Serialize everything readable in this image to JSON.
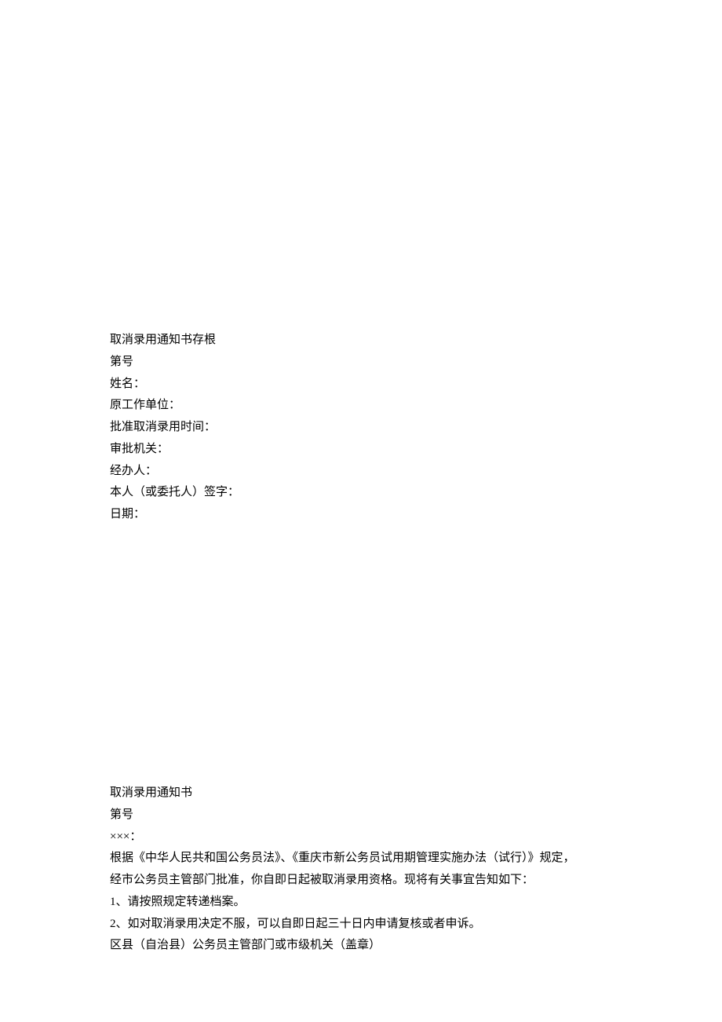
{
  "section1": {
    "title": "取消录用通知书存根",
    "number": "第号",
    "name": "姓名：",
    "original_unit": "原工作单位：",
    "approved_cancel_time": "批准取消录用时间：",
    "approval_authority": "审批机关：",
    "handler": "经办人：",
    "signature": "本人（或委托人）签字：",
    "date": "日期："
  },
  "section2": {
    "title": "取消录用通知书",
    "number": "第号",
    "addressee": "×××：",
    "body_line1": "根据《中华人民共和国公务员法》、《重庆市新公务员试用期管理实施办法（试行）》规定，",
    "body_line2": "经市公务员主管部门批准，你自即日起被取消录用资格。现将有关事宜告知如下：",
    "item1": "1、请按照规定转递档案。",
    "item2": "2、如对取消录用决定不服，可以自即日起三十日内申请复核或者申诉。",
    "footer": "区县（自治县）公务员主管部门或市级机关（盖章）"
  }
}
